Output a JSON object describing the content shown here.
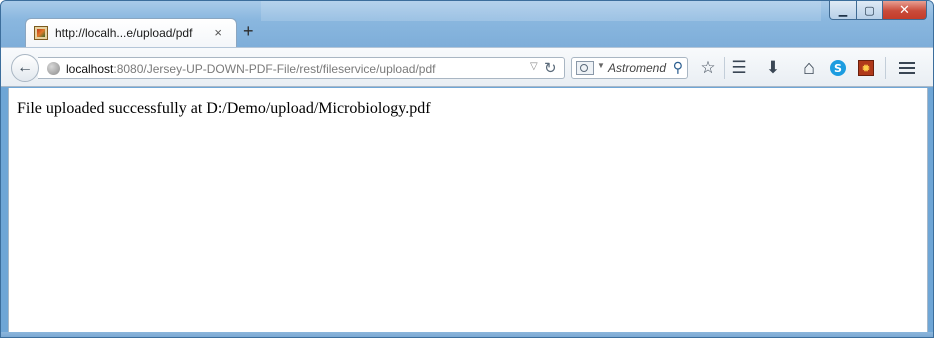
{
  "window": {
    "controls": {
      "minimize": "▁",
      "maximize": "▢",
      "close": "✕"
    }
  },
  "tabs": [
    {
      "title": "http://localh...e/upload/pdf",
      "close": "×"
    }
  ],
  "new_tab": "+",
  "navbar": {
    "back": "←",
    "url_host": "localhost",
    "url_rest": ":8080/Jersey-UP-DOWN-PDF-File/rest/fileservice/upload/pdf",
    "url_dropdown": "▽",
    "reload": "↻",
    "search": {
      "dropdown": "▼",
      "placeholder": "Astromend",
      "go": "⚲"
    },
    "icons": [
      "bookmark-star-icon",
      "reading-list-icon",
      "download-icon",
      "home-icon",
      "skype-icon",
      "extension-icon",
      "menu-icon"
    ],
    "icon_glyphs": {
      "star": "☆",
      "list": "☰",
      "download": "⬇",
      "home": "⌂",
      "skype": "S",
      "ext": "✹"
    }
  },
  "page": {
    "message": "File uploaded successfully at D:/Demo/upload/Microbiology.pdf"
  }
}
